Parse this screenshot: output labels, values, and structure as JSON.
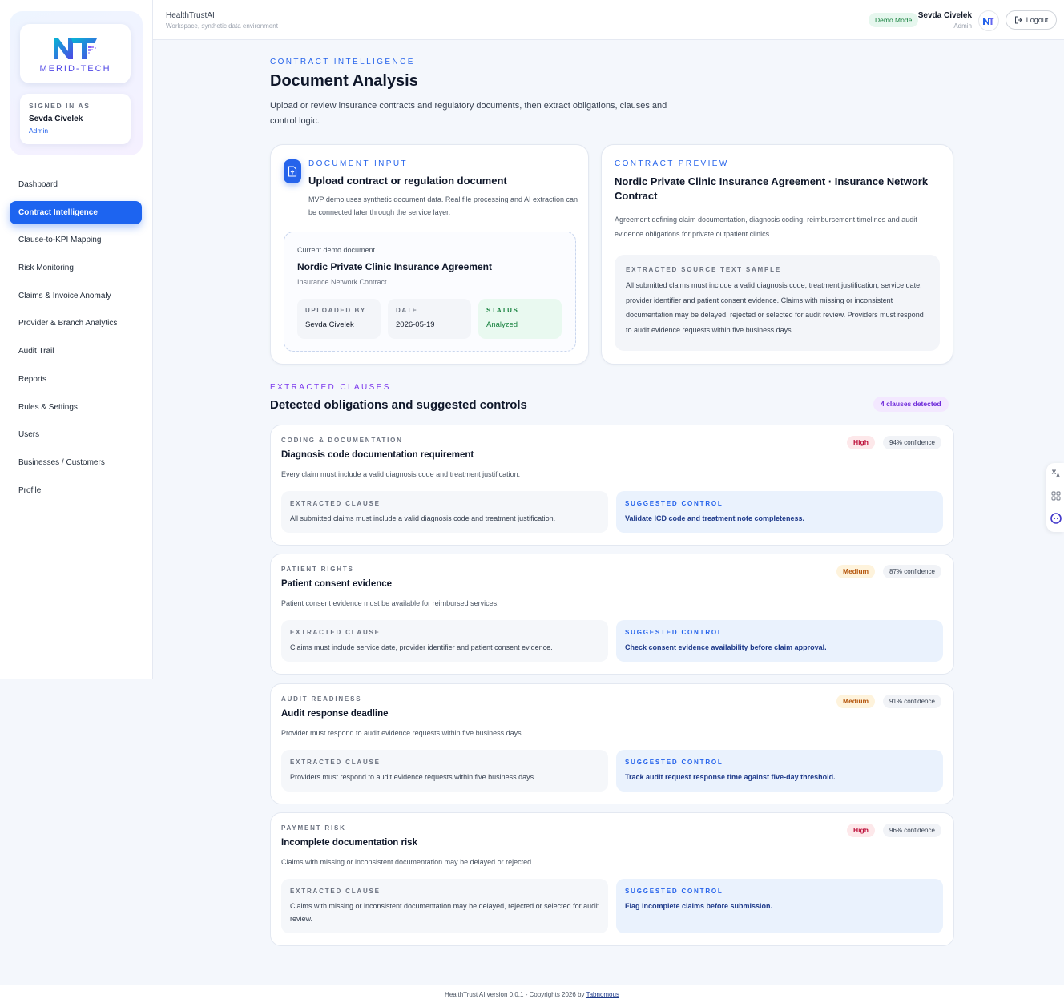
{
  "topbar": {
    "app_name": "HealthTrustAI",
    "app_subtitle": "Workspace, synthetic data environment",
    "demo_badge": "Demo Mode",
    "user_name": "Sevda Civelek",
    "user_role": "Admin",
    "logout_label": "Logout"
  },
  "sidebar": {
    "logo_text": "MERID-TECH",
    "signed_in_label": "SIGNED IN AS",
    "signed_in_name": "Sevda Civelek",
    "signed_in_role": "Admin",
    "items": [
      {
        "label": "Dashboard"
      },
      {
        "label": "Contract Intelligence"
      },
      {
        "label": "Clause-to-KPI Mapping"
      },
      {
        "label": "Risk Monitoring"
      },
      {
        "label": "Claims & Invoice Anomaly"
      },
      {
        "label": "Provider & Branch Analytics"
      },
      {
        "label": "Audit Trail"
      },
      {
        "label": "Reports"
      },
      {
        "label": "Rules & Settings"
      },
      {
        "label": "Users"
      },
      {
        "label": "Businesses / Customers"
      },
      {
        "label": "Profile"
      }
    ],
    "active_index": 1
  },
  "page": {
    "eyebrow": "CONTRACT INTELLIGENCE",
    "title": "Document Analysis",
    "description": "Upload or review insurance contracts and regulatory documents, then extract obligations, clauses and control logic."
  },
  "upload": {
    "eyebrow": "DOCUMENT INPUT",
    "title": "Upload contract or regulation document",
    "description": "MVP demo uses synthetic document data. Real file processing and AI extraction can be connected later through the service layer.",
    "current_label": "Current demo document",
    "doc_title": "Nordic Private Clinic Insurance Agreement",
    "doc_type": "Insurance Network Contract",
    "uploaded_by_label": "UPLOADED BY",
    "uploaded_by": "Sevda Civelek",
    "date_label": "DATE",
    "date": "2026-05-19",
    "status_label": "STATUS",
    "status": "Analyzed"
  },
  "preview": {
    "eyebrow": "CONTRACT PREVIEW",
    "title": "Nordic Private Clinic Insurance Agreement · Insurance Network Contract",
    "description": "Agreement defining claim documentation, diagnosis coding, reimbursement timelines and audit evidence obligations for private outpatient clinics.",
    "sample_label": "EXTRACTED SOURCE TEXT SAMPLE",
    "sample_text": "All submitted claims must include a valid diagnosis code, treatment justification, service date, provider identifier and patient consent evidence. Claims with missing or inconsistent documentation may be delayed, rejected or selected for audit review. Providers must respond to audit evidence requests within five business days."
  },
  "clauses": {
    "eyebrow": "EXTRACTED CLAUSES",
    "title": "Detected obligations and suggested controls",
    "count_badge": "4 clauses detected",
    "extracted_label": "EXTRACTED CLAUSE",
    "control_label": "SUGGESTED CONTROL",
    "items": [
      {
        "category": "CODING & DOCUMENTATION",
        "title": "Diagnosis code documentation requirement",
        "description": "Every claim must include a valid diagnosis code and treatment justification.",
        "severity": "High",
        "confidence": "94% confidence",
        "extracted": "All submitted claims must include a valid diagnosis code and treatment justification.",
        "control": "Validate ICD code and treatment note completeness."
      },
      {
        "category": "PATIENT RIGHTS",
        "title": "Patient consent evidence",
        "description": "Patient consent evidence must be available for reimbursed services.",
        "severity": "Medium",
        "confidence": "87% confidence",
        "extracted": "Claims must include service date, provider identifier and patient consent evidence.",
        "control": "Check consent evidence availability before claim approval."
      },
      {
        "category": "AUDIT READINESS",
        "title": "Audit response deadline",
        "description": "Provider must respond to audit evidence requests within five business days.",
        "severity": "Medium",
        "confidence": "91% confidence",
        "extracted": "Providers must respond to audit evidence requests within five business days.",
        "control": "Track audit request response time against five-day threshold."
      },
      {
        "category": "PAYMENT RISK",
        "title": "Incomplete documentation risk",
        "description": "Claims with missing or inconsistent documentation may be delayed or rejected.",
        "severity": "High",
        "confidence": "96% confidence",
        "extracted": "Claims with missing or inconsistent documentation may be delayed, rejected or selected for audit review.",
        "control": "Flag incomplete claims before submission."
      }
    ]
  },
  "footer": {
    "text": "HealthTrust AI version 0.0.1 - Copyrights 2026 by",
    "link": "Tabnomous"
  },
  "colors": {
    "accent": "#1d64f0",
    "high": "#be123c",
    "medium": "#b45309",
    "success": "#15803d"
  }
}
